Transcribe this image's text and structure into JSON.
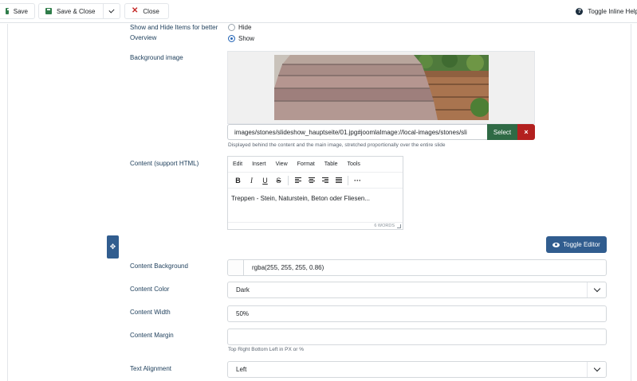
{
  "toolbar": {
    "save_label": "Save",
    "save_close_label": "Save & Close",
    "close_label": "Close",
    "help_label": "Toggle Inline Help"
  },
  "fields": {
    "show_hide": {
      "label": "Show and Hide Items for better Overview",
      "options": [
        "Hide",
        "Show"
      ],
      "selected": "Show"
    },
    "background_image": {
      "label": "Background image",
      "value": "images/stones/slideshow_hauptseite/01.jpg#joomlaImage://local-images/stones/sli",
      "select_label": "Select",
      "clear_label": "×",
      "help": "Displayed behind the content and the main image, stretched proportionally over the entire slide"
    },
    "content": {
      "label": "Content (support HTML)",
      "menu": [
        "Edit",
        "Insert",
        "View",
        "Format",
        "Table",
        "Tools"
      ],
      "text": "Treppen - Stein, Naturstein, Beton oder Fliesen...",
      "status": "6 WORDS",
      "toggle_editor": "Toggle Editor"
    },
    "content_background": {
      "label": "Content Background",
      "value": "rgba(255, 255, 255, 0.86)"
    },
    "content_color": {
      "label": "Content Color",
      "value": "Dark"
    },
    "content_width": {
      "label": "Content Width",
      "value": "50%"
    },
    "content_margin": {
      "label": "Content Margin",
      "value": "",
      "help": "Top Right Bottom Left in PX or %"
    },
    "text_alignment": {
      "label": "Text Alignment",
      "value": "Left"
    }
  },
  "colors": {
    "select_btn": "#2f6a45",
    "clear_btn": "#b3201f",
    "primary": "#315d8f",
    "label": "#1c3d5a"
  }
}
